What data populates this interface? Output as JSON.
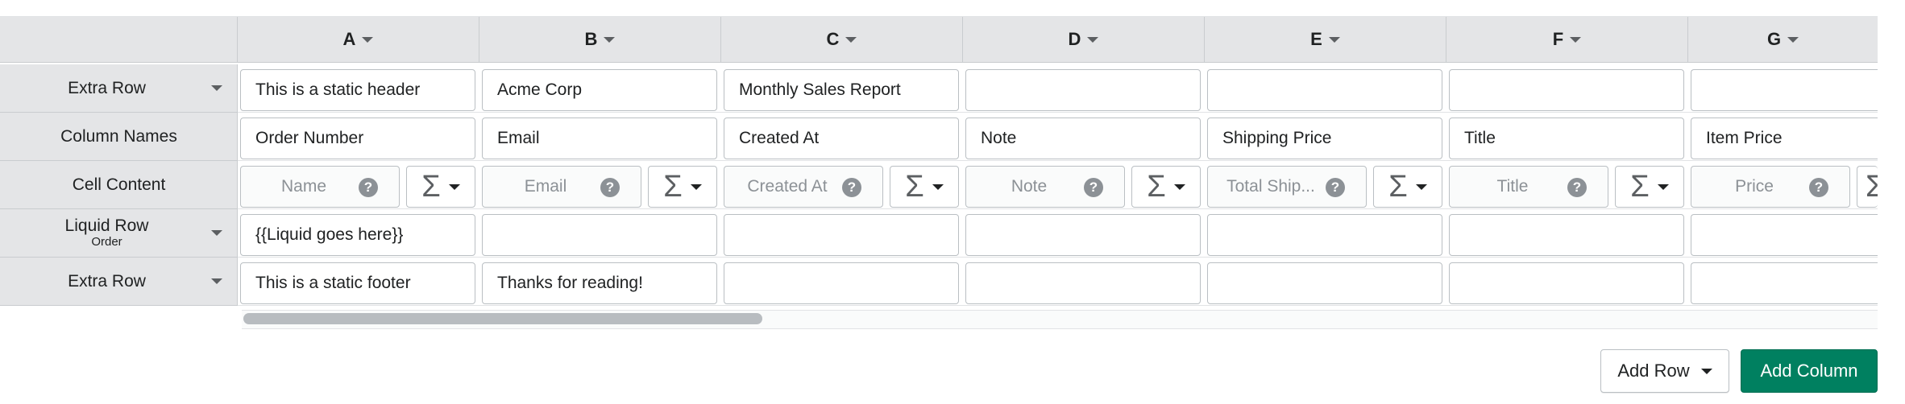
{
  "columns": [
    {
      "letter": "A",
      "extra_row": "This is a static header",
      "column_name": "Order Number",
      "placeholder": "Name",
      "liquid": "{{Liquid goes here}}",
      "footer": "This is a static footer"
    },
    {
      "letter": "B",
      "extra_row": "Acme Corp",
      "column_name": "Email",
      "placeholder": "Email",
      "liquid": "",
      "footer": "Thanks for reading!"
    },
    {
      "letter": "C",
      "extra_row": "Monthly Sales Report",
      "column_name": "Created At",
      "placeholder": "Created At",
      "liquid": "",
      "footer": ""
    },
    {
      "letter": "D",
      "extra_row": "",
      "column_name": "Note",
      "placeholder": "Note",
      "liquid": "",
      "footer": ""
    },
    {
      "letter": "E",
      "extra_row": "",
      "column_name": "Shipping Price",
      "placeholder": "Total Ship...",
      "liquid": "",
      "footer": ""
    },
    {
      "letter": "F",
      "extra_row": "",
      "column_name": "Title",
      "placeholder": "Title",
      "liquid": "",
      "footer": ""
    },
    {
      "letter": "G",
      "extra_row": "",
      "column_name": "Item Price",
      "placeholder": "Price",
      "liquid": "",
      "footer": ""
    }
  ],
  "rows": [
    {
      "label": "Extra Row",
      "sublabel": "",
      "has_menu": true
    },
    {
      "label": "Column Names",
      "sublabel": "",
      "has_menu": false
    },
    {
      "label": "Cell Content",
      "sublabel": "",
      "has_menu": false
    },
    {
      "label": "Liquid Row",
      "sublabel": "Order",
      "has_menu": true
    },
    {
      "label": "Extra Row",
      "sublabel": "",
      "has_menu": true
    }
  ],
  "icons": {
    "help": "?",
    "sum": "Σ"
  },
  "buttons": {
    "add_row": "Add Row",
    "add_column": "Add Column"
  },
  "colors": {
    "primary": "#008060",
    "header_bg": "#e4e5e7"
  }
}
